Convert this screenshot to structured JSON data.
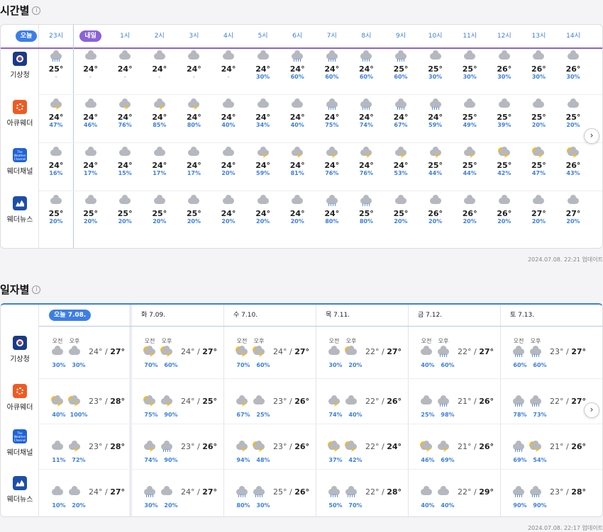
{
  "hourly": {
    "title": "시간별",
    "info_icon": "info-icon",
    "providers": [
      "기상청",
      "아큐웨더",
      "웨더채널",
      "웨더뉴스"
    ],
    "hours": [
      "23시",
      "1시",
      "2시",
      "3시",
      "4시",
      "5시",
      "6시",
      "7시",
      "8시",
      "9시",
      "10시",
      "11시",
      "12시",
      "13시",
      "14시"
    ],
    "today_label": "오늘",
    "tomorrow_label": "내일",
    "rows": [
      {
        "temps": [
          "25°",
          "24°",
          "24°",
          "24°",
          "24°",
          "24°",
          "24°",
          "24°",
          "24°",
          "24°",
          "25°",
          "25°",
          "25°",
          "26°",
          "26°",
          "26°"
        ],
        "pcts": [
          "-",
          "-",
          "-",
          "-",
          "-",
          "-",
          "30%",
          "60%",
          "60%",
          "60%",
          "60%",
          "30%",
          "30%",
          "30%",
          "30%",
          "30%"
        ],
        "icons": [
          "cloud-rain",
          "cloud",
          "cloud",
          "cloud",
          "cloud",
          "cloud",
          "cloud",
          "rain",
          "rain",
          "rain",
          "rain",
          "cloud",
          "cloud",
          "cloud",
          "cloud",
          "cloud"
        ]
      },
      {
        "temps": [
          "24°",
          "24°",
          "24°",
          "24°",
          "24°",
          "24°",
          "24°",
          "24°",
          "24°",
          "24°",
          "24°",
          "24°",
          "25°",
          "25°",
          "25°",
          "25°"
        ],
        "pcts": [
          "47%",
          "46%",
          "76%",
          "85%",
          "80%",
          "40%",
          "34%",
          "40%",
          "75%",
          "74%",
          "67%",
          "59%",
          "49%",
          "39%",
          "20%",
          "20%"
        ],
        "icons": [
          "cloud-storm",
          "cloud",
          "cloud-storm",
          "cloud-storm",
          "cloud-storm",
          "cloud",
          "cloud",
          "cloud",
          "rain",
          "rain",
          "rain",
          "rain",
          "cloud",
          "cloud",
          "cloud",
          "cloud"
        ]
      },
      {
        "temps": [
          "24°",
          "24°",
          "24°",
          "24°",
          "24°",
          "24°",
          "24°",
          "24°",
          "24°",
          "24°",
          "24°",
          "25°",
          "25°",
          "25°",
          "25°",
          "26°"
        ],
        "pcts": [
          "16%",
          "17%",
          "15%",
          "17%",
          "17%",
          "20%",
          "59%",
          "81%",
          "76%",
          "76%",
          "53%",
          "44%",
          "44%",
          "42%",
          "47%",
          "43%"
        ],
        "icons": [
          "cloud",
          "cloud",
          "cloud",
          "cloud",
          "cloud",
          "cloud",
          "storm",
          "storm",
          "storm",
          "storm",
          "storm",
          "storm",
          "storm",
          "sun-storm",
          "sun-storm",
          "sun-storm"
        ]
      },
      {
        "temps": [
          "25°",
          "25°",
          "25°",
          "25°",
          "25°",
          "24°",
          "24°",
          "24°",
          "24°",
          "25°",
          "25°",
          "26°",
          "26°",
          "26°",
          "27°",
          "27°"
        ],
        "pcts": [
          "20%",
          "20%",
          "20%",
          "20%",
          "20%",
          "20%",
          "20%",
          "20%",
          "80%",
          "80%",
          "20%",
          "20%",
          "20%",
          "20%",
          "20%",
          "20%"
        ],
        "icons": [
          "cloud",
          "cloud",
          "cloud",
          "cloud",
          "cloud",
          "cloud",
          "cloud",
          "cloud",
          "rain",
          "rain",
          "cloud",
          "cloud",
          "cloud",
          "cloud",
          "cloud",
          "cloud"
        ]
      }
    ],
    "update": "2024.07.08. 22:21 업데이트"
  },
  "daily": {
    "title": "일자별",
    "info_icon": "info-icon",
    "providers": [
      "기상청",
      "아큐웨더",
      "웨더채널",
      "웨더뉴스"
    ],
    "days": [
      "오늘 7.08.",
      "화 7.09.",
      "수 7.10.",
      "목 7.11.",
      "금 7.12.",
      "토 7.13."
    ],
    "am": "오전",
    "pm": "오후",
    "cells": [
      [
        [
          "30%",
          "30%",
          "24°",
          "27°",
          "cloud",
          "cloud"
        ],
        [
          "70%",
          "60%",
          "24°",
          "27°",
          "sun-storm",
          "sun-storm"
        ],
        [
          "70%",
          "60%",
          "24°",
          "27°",
          "sun-storm",
          "sun-storm"
        ],
        [
          "30%",
          "20%",
          "22°",
          "27°",
          "cloud",
          "sun-cloud"
        ],
        [
          "40%",
          "60%",
          "22°",
          "27°",
          "cloud",
          "rain"
        ],
        [
          "60%",
          "60%",
          "23°",
          "27°",
          "rain",
          "rain"
        ]
      ],
      [
        [
          "40%",
          "100%",
          "23°",
          "28°",
          "sun-storm",
          "sun-storm"
        ],
        [
          "75%",
          "90%",
          "24°",
          "25°",
          "sun-storm",
          "storm"
        ],
        [
          "67%",
          "25%",
          "23°",
          "26°",
          "storm",
          "cloud"
        ],
        [
          "74%",
          "40%",
          "22°",
          "26°",
          "storm",
          "cloud"
        ],
        [
          "25%",
          "98%",
          "21°",
          "26°",
          "cloud",
          "rain"
        ],
        [
          "78%",
          "73%",
          "22°",
          "27°",
          "rain",
          "rain"
        ]
      ],
      [
        [
          "11%",
          "72%",
          "23°",
          "28°",
          "cloud",
          "storm"
        ],
        [
          "74%",
          "90%",
          "23°",
          "26°",
          "storm",
          "rain"
        ],
        [
          "94%",
          "48%",
          "23°",
          "26°",
          "storm",
          "sun-storm"
        ],
        [
          "37%",
          "42%",
          "22°",
          "24°",
          "sun-storm",
          "sun-storm"
        ],
        [
          "46%",
          "69%",
          "21°",
          "26°",
          "sun-storm",
          "storm"
        ],
        [
          "69%",
          "54%",
          "21°",
          "26°",
          "rain",
          "sun-storm"
        ]
      ],
      [
        [
          "10%",
          "20%",
          "24°",
          "27°",
          "cloud",
          "cloud"
        ],
        [
          "30%",
          "20%",
          "24°",
          "27°",
          "rain",
          "cloud"
        ],
        [
          "80%",
          "30%",
          "25°",
          "26°",
          "rain",
          "rain"
        ],
        [
          "50%",
          "70%",
          "22°",
          "28°",
          "rain",
          "rain"
        ],
        [
          "40%",
          "40%",
          "22°",
          "29°",
          "cloud",
          "cloud"
        ],
        [
          "90%",
          "90%",
          "23°",
          "28°",
          "rain",
          "rain"
        ]
      ]
    ],
    "update": "2024.07.08. 22:17 업데이트"
  }
}
